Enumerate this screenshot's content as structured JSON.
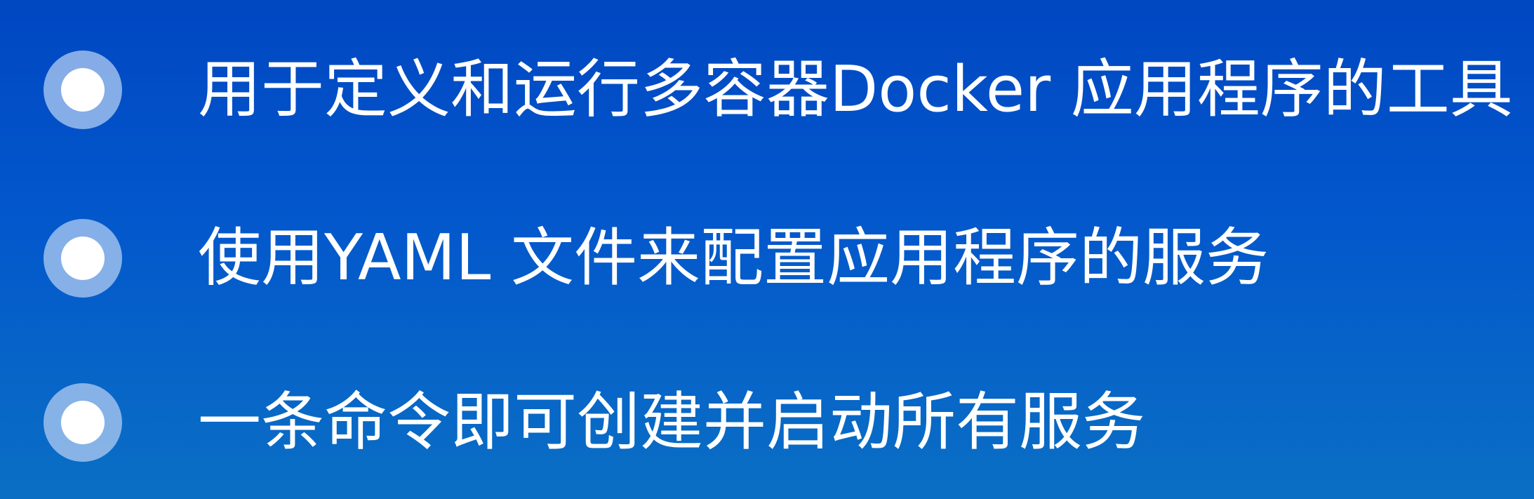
{
  "bullets": [
    {
      "text": "用于定义和运行多容器Docker 应用程序的工具"
    },
    {
      "text": "使用YAML 文件来配置应用程序的服务"
    },
    {
      "text": "一条命令即可创建并启动所有服务"
    }
  ],
  "colors": {
    "background_top": "#0047c2",
    "background_bottom": "#0a6fc4",
    "text": "#ffffff",
    "bullet_outer": "#aac8f0",
    "bullet_inner": "#ffffff"
  },
  "icons": {
    "bullet": "circle-bullet-icon"
  }
}
